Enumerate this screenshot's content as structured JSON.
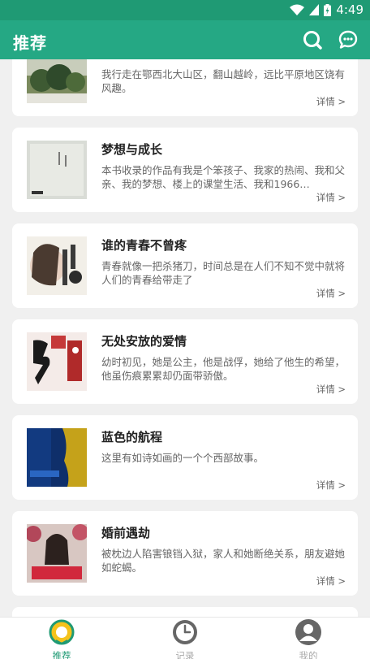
{
  "status": {
    "time": "4:49"
  },
  "appbar": {
    "title": "推荐",
    "search_icon": "search-icon",
    "chat_icon": "chat-icon"
  },
  "colors": {
    "primary": "#25a884",
    "statusbar": "#1f9a74",
    "background": "#f0f0f0"
  },
  "books": [
    {
      "title": "",
      "desc": "我行走在鄂西北大山区，翻山越岭，远比平原地区饶有风趣。",
      "detail": "详情 >"
    },
    {
      "title": "梦想与成长",
      "desc": "本书收录的作品有我是个笨孩子、我家的热闹、我和父亲、我的梦想、楼上的课堂生活、我和1966…",
      "detail": "详情 >"
    },
    {
      "title": "谁的青春不曾疼",
      "desc": "青春就像一把杀猪刀，时间总是在人们不知不觉中就将人们的青春给带走了",
      "detail": "详情 >"
    },
    {
      "title": "无处安放的爱情",
      "desc": "幼时初见，她是公主，他是战俘，她给了他生的希望，他虽伤痕累累却仍面带骄傲。",
      "detail": "详情 >"
    },
    {
      "title": "蓝色的航程",
      "desc": "这里有如诗如画的一个个西部故事。",
      "detail": "详情 >"
    },
    {
      "title": "婚前遇劫",
      "desc": "被枕边人陷害锒铛入狱，家人和她断绝关系，朋友避她如蛇蝎。",
      "detail": "详情 >"
    }
  ],
  "tabs": [
    {
      "label": "推荐",
      "icon": "recommend-icon",
      "active": true
    },
    {
      "label": "记录",
      "icon": "clock-icon",
      "active": false
    },
    {
      "label": "我的",
      "icon": "profile-icon",
      "active": false
    }
  ]
}
